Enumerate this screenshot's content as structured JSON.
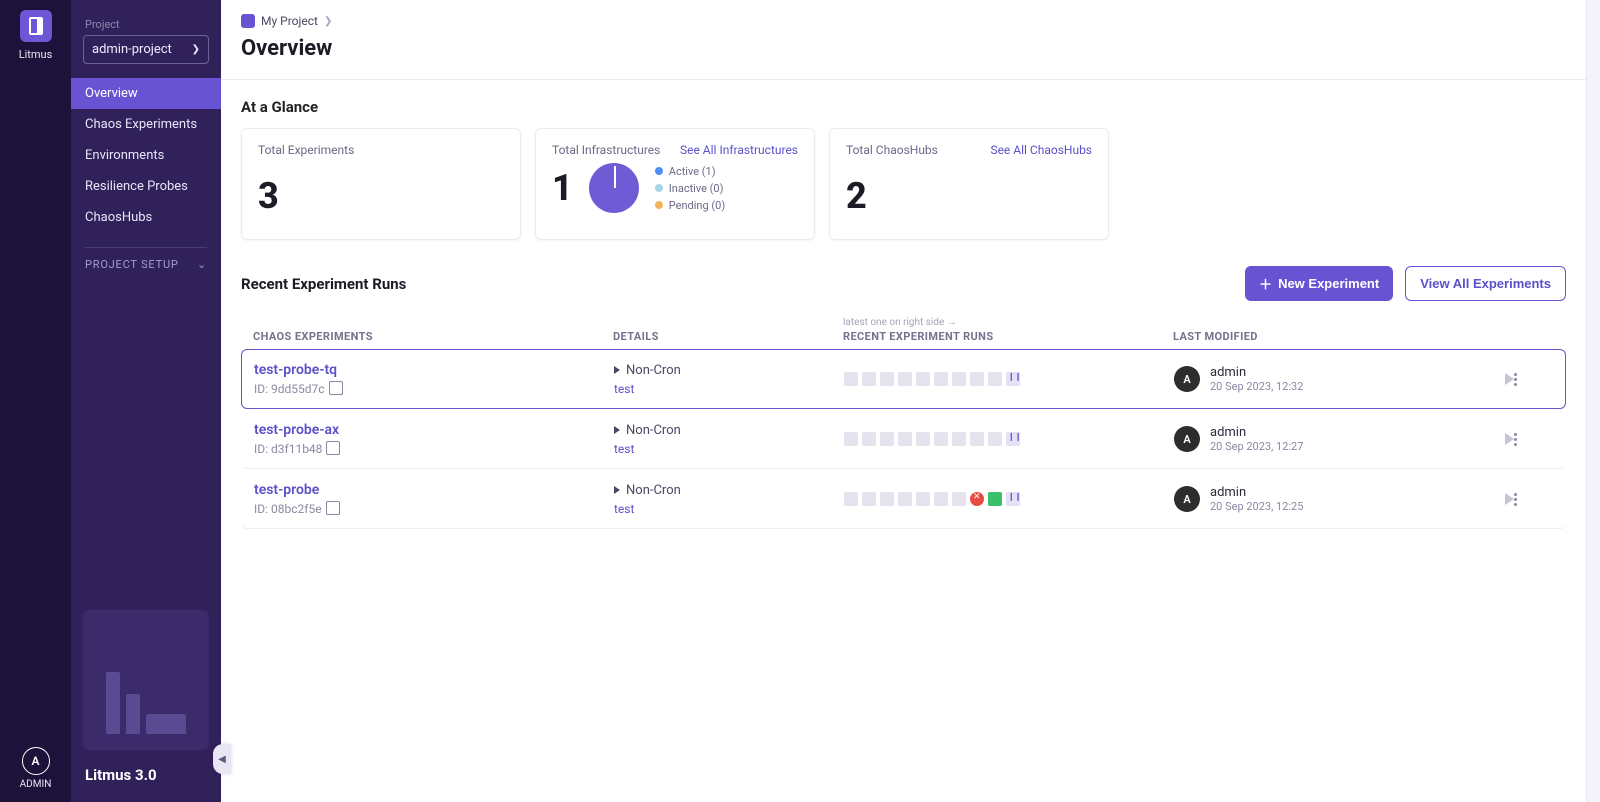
{
  "app": {
    "name": "Litmus",
    "version": "Litmus 3.0"
  },
  "user": {
    "initial": "A",
    "label": "ADMIN"
  },
  "sidebar": {
    "project_label": "Project",
    "project_value": "admin-project",
    "items": [
      {
        "label": "Overview",
        "active": true
      },
      {
        "label": "Chaos Experiments"
      },
      {
        "label": "Environments"
      },
      {
        "label": "Resilience Probes"
      },
      {
        "label": "ChaosHubs"
      }
    ],
    "setup_label": "PROJECT SETUP"
  },
  "breadcrumb": {
    "root": "My Project"
  },
  "page_title": "Overview",
  "glance": {
    "title": "At a Glance",
    "experiments": {
      "label": "Total Experiments",
      "value": "3"
    },
    "infra": {
      "label": "Total Infrastructures",
      "link": "See All Infrastructures",
      "value": "1",
      "legend": {
        "active": "Active (1)",
        "inactive": "Inactive (0)",
        "pending": "Pending (0)"
      }
    },
    "hubs": {
      "label": "Total ChaosHubs",
      "link": "See All ChaosHubs",
      "value": "2"
    }
  },
  "recent": {
    "title": "Recent Experiment Runs",
    "new_btn": "New Experiment",
    "view_all_btn": "View All Experiments",
    "columns": {
      "chaos": "CHAOS EXPERIMENTS",
      "details": "DETAILS",
      "recent_hint": "latest one on right side  →",
      "recent": "RECENT EXPERIMENT RUNS",
      "modified": "LAST MODIFIED"
    },
    "rows": [
      {
        "name": "test-probe-tq",
        "id_label": "ID: 9dd55d7c",
        "type": "Non-Cron",
        "env": "test",
        "runs": [
          "n",
          "n",
          "n",
          "n",
          "n",
          "n",
          "n",
          "n",
          "n",
          "running"
        ],
        "who": "admin",
        "when": "20 Sep 2023, 12:32",
        "avatar": "A"
      },
      {
        "name": "test-probe-ax",
        "id_label": "ID: d3f11b48",
        "type": "Non-Cron",
        "env": "test",
        "runs": [
          "n",
          "n",
          "n",
          "n",
          "n",
          "n",
          "n",
          "n",
          "n",
          "running"
        ],
        "who": "admin",
        "when": "20 Sep 2023, 12:27",
        "avatar": "A"
      },
      {
        "name": "test-probe",
        "id_label": "ID: 08bc2f5e",
        "type": "Non-Cron",
        "env": "test",
        "runs": [
          "n",
          "n",
          "n",
          "n",
          "n",
          "n",
          "n",
          "err",
          "ok",
          "running"
        ],
        "who": "admin",
        "when": "20 Sep 2023, 12:25",
        "avatar": "A"
      }
    ]
  }
}
